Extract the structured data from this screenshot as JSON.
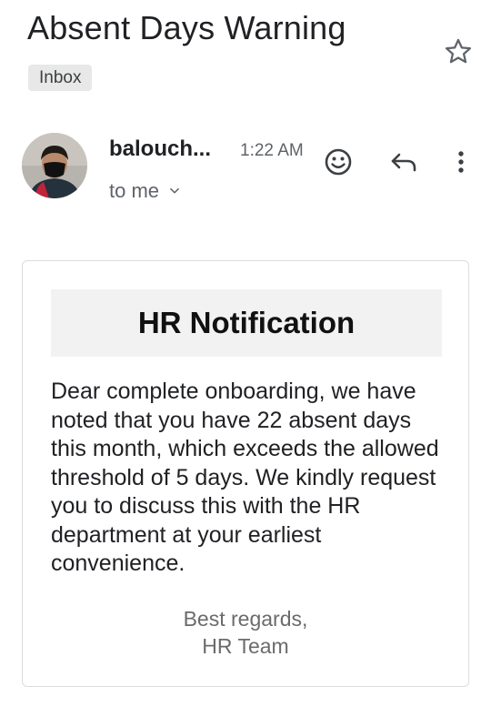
{
  "email": {
    "subject": "Absent Days Warning",
    "label": "Inbox",
    "sender": "balouch...",
    "time": "1:22 AM",
    "recipient": "to me"
  },
  "icons": {
    "star": "star-outline-icon",
    "emoji": "smiley-icon",
    "reply": "reply-arrow-icon",
    "more": "vertical-dots-icon",
    "expand": "chevron-down-icon"
  },
  "card": {
    "title": "HR Notification",
    "body": "Dear complete onboarding, we have noted that you have 22 absent days this month, which exceeds the allowed threshold of 5 days. We kindly request you to discuss this with the HR department at your earliest convenience.",
    "signoff": "Best regards,",
    "signature": "HR Team"
  },
  "colors": {
    "text_primary": "#202124",
    "text_secondary": "#5f6368",
    "chip_bg": "#e8e8e8",
    "card_border": "#dadce0",
    "header_bg": "#f2f2f2"
  }
}
